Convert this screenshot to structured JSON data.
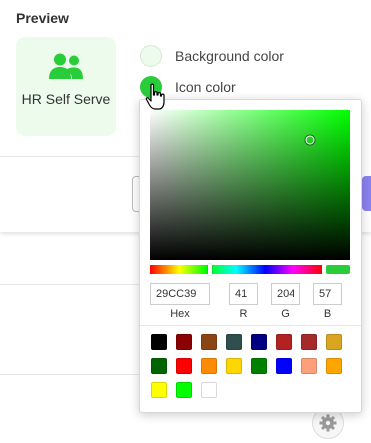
{
  "preview": {
    "section_title": "Preview",
    "app_name": "HR Self Serve",
    "icon": "people-group-icon",
    "icon_color": "#29CC39",
    "background_color": "#ecfbec"
  },
  "color_options": {
    "background_label": "Background color",
    "icon_label": "Icon color"
  },
  "color_picker": {
    "hex_value": "29CC39",
    "r_value": "41",
    "g_value": "204",
    "b_value": "57",
    "hex_label": "Hex",
    "r_label": "R",
    "g_label": "G",
    "b_label": "B",
    "hue_level": 0.35,
    "saturation_level": 0.8,
    "brightness_level": 0.8,
    "preset_colors": [
      "#000000",
      "#8B0000",
      "#8B4513",
      "#2F4F4F",
      "#000080",
      "#B22222",
      "#A52A2A",
      "#DAA520",
      "#006400",
      "#FF0000",
      "#FF8C00",
      "#FFD700",
      "#008000",
      "#0000FF",
      "#FFA07A",
      "#FFA500",
      "#FFFF00",
      "#00FF00",
      "#FFFFFF"
    ]
  },
  "footer": {
    "settings_icon": "gear-icon"
  }
}
